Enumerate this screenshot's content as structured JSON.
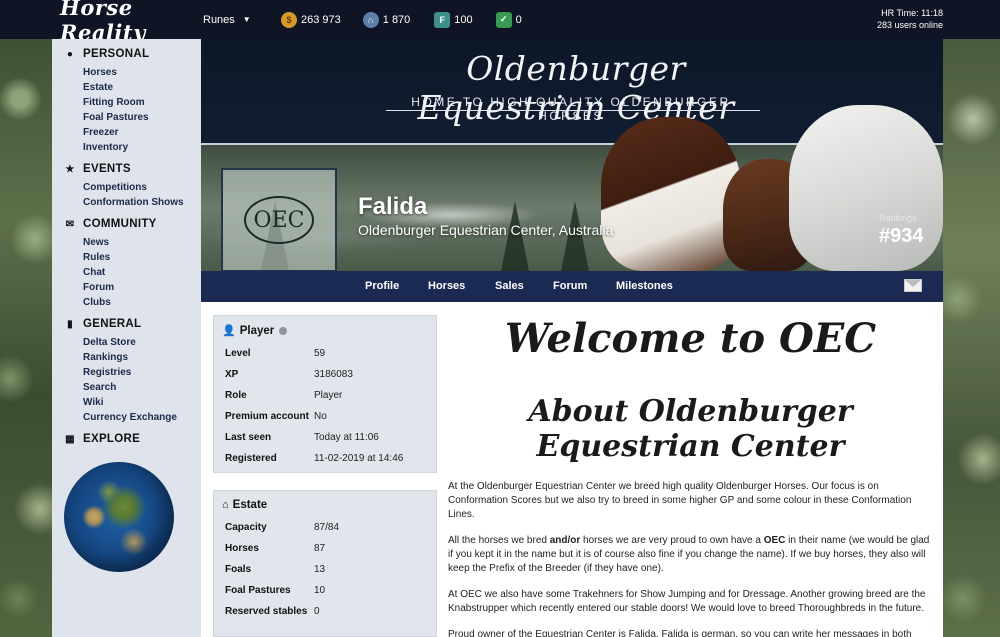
{
  "topbar": {
    "logo": "Horse Reality",
    "runes_label": "Runes",
    "currencies": [
      {
        "icon": "gold-coin-icon",
        "value": "263 973",
        "color": "#d59a2b"
      },
      {
        "icon": "horseshoe-token-icon",
        "value": "1 870",
        "color": "#5d7fa8"
      },
      {
        "icon": "ticket-icon",
        "value": "100",
        "color": "#3f8f8a"
      },
      {
        "icon": "cash-icon",
        "value": "0",
        "color": "#3a9a55"
      }
    ],
    "hr_time": "HR Time: 11:18",
    "users_online": "283 users online"
  },
  "sidebar": {
    "sections": [
      {
        "title": "PERSONAL",
        "icon": "user-circle-icon",
        "items": [
          "Horses",
          "Estate",
          "Fitting Room",
          "Foal Pastures",
          "Freezer",
          "Inventory"
        ]
      },
      {
        "title": "EVENTS",
        "icon": "star-icon",
        "items": [
          "Competitions",
          "Conformation Shows"
        ]
      },
      {
        "title": "COMMUNITY",
        "icon": "chat-bubbles-icon",
        "items": [
          "News",
          "Rules",
          "Chat",
          "Forum",
          "Clubs"
        ]
      },
      {
        "title": "GENERAL",
        "icon": "bookmark-icon",
        "items": [
          "Delta Store",
          "Rankings",
          "Registries",
          "Search",
          "Wiki",
          "Currency Exchange"
        ]
      },
      {
        "title": "EXPLORE",
        "icon": "map-icon",
        "items": []
      }
    ]
  },
  "banner": {
    "title": "Oldenburger Equestrian Center",
    "subtitle": "HOME TO HIGH QUALITY OLDENBURGER HORSES",
    "emblem_text": "OEC",
    "player_name": "Falida",
    "player_location": "Oldenburger Equestrian Center, Australia",
    "rankings_label": "Rankings",
    "rankings_value": "#934"
  },
  "nav": {
    "tabs": [
      "Profile",
      "Horses",
      "Sales",
      "Forum",
      "Milestones"
    ]
  },
  "player_panel": {
    "title": "Player",
    "rows": [
      {
        "k": "Level",
        "v": "59"
      },
      {
        "k": "XP",
        "v": "3186083"
      },
      {
        "k": "Role",
        "v": "Player"
      },
      {
        "k": "Premium account",
        "v": "No"
      },
      {
        "k": "Last seen",
        "v": "Today at 11:06"
      },
      {
        "k": "Registered",
        "v": "11-02-2019 at 14:46"
      }
    ]
  },
  "estate_panel": {
    "title": "Estate",
    "rows": [
      {
        "k": "Capacity",
        "v": "87/84"
      },
      {
        "k": "Horses",
        "v": "87"
      },
      {
        "k": "Foals",
        "v": "13"
      },
      {
        "k": "Foal Pastures",
        "v": "10"
      },
      {
        "k": "Reserved stables",
        "v": "0"
      }
    ]
  },
  "content": {
    "welcome": "Welcome to OEC",
    "about": "About Oldenburger Equestrian Center",
    "p1": "At the Oldenburger Equestrian Center we breed high quality Oldenburger Horses. Our focus is on Conformation Scores but we also try to breed in some higher GP and some colour in these Conformation Lines.",
    "p2_a": "All the horses we bred ",
    "p2_b": "and/or",
    "p2_c": " horses we are very proud to own have a ",
    "p2_d": "OEC",
    "p2_e": " in their name (we would be glad if you kept it in the name but it is of course also fine if you change the name). If we buy horses, they also will keep the Prefix of the Breeder (if they have one).",
    "p3": "At OEC we also have some Trakehners for Show Jumping and for Dressage. Another growing breed are the Knabstrupper which recently entered our stable doors! We would love to breed Thoroughbreds in the future.",
    "p4": "Proud owner of the Equestrian Center is Falida. Falida is german, so you can write her messages in both english and german."
  }
}
